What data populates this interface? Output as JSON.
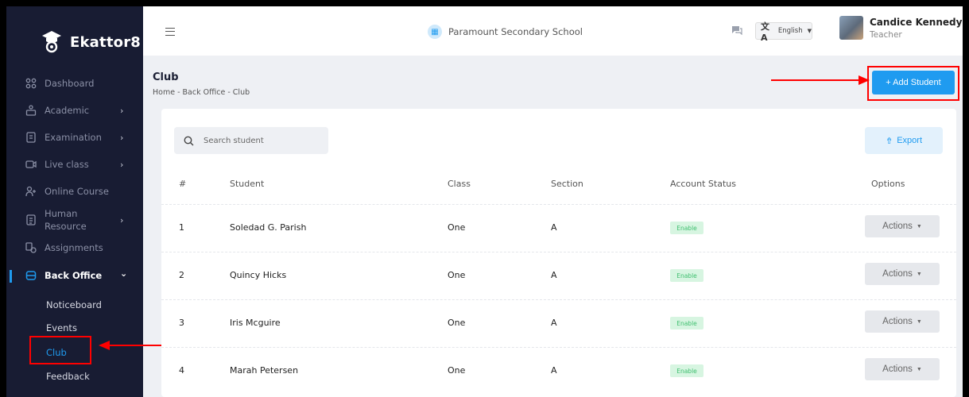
{
  "brand": {
    "name": "Ekattor8"
  },
  "sidebar": {
    "items": [
      {
        "label": "Dashboard",
        "icon": "grid-icon",
        "chevron": ""
      },
      {
        "label": "Academic",
        "icon": "academic-icon",
        "chevron": "›"
      },
      {
        "label": "Examination",
        "icon": "exam-icon",
        "chevron": "›"
      },
      {
        "label": "Live class",
        "icon": "video-icon",
        "chevron": "›"
      },
      {
        "label": "Online Course",
        "icon": "user-plus-icon",
        "chevron": ""
      },
      {
        "label": "Human",
        "label2": "Resource",
        "icon": "document-icon",
        "chevron": "›"
      },
      {
        "label": "Assignments",
        "icon": "assignment-icon",
        "chevron": ""
      },
      {
        "label": "Back Office",
        "icon": "database-icon",
        "chevron": "⌄"
      }
    ],
    "subitems": [
      "Noticeboard",
      "Events",
      "Club",
      "Feedback"
    ]
  },
  "header": {
    "school": "Paramount Secondary School",
    "language": "English",
    "user_name": "Candice Kennedy",
    "user_role": "Teacher"
  },
  "page": {
    "title": "Club",
    "breadcrumb": "Home - Back Office - Club",
    "add_button": "+ Add Student"
  },
  "toolbar": {
    "search_placeholder": "Search student",
    "export_label": "Export"
  },
  "table": {
    "headers": [
      "#",
      "Student",
      "Class",
      "Section",
      "Account Status",
      "Options"
    ],
    "rows": [
      {
        "num": "1",
        "student": "Soledad G. Parish",
        "class": "One",
        "section": "A",
        "status": "Enable",
        "action": "Actions"
      },
      {
        "num": "2",
        "student": "Quincy Hicks",
        "class": "One",
        "section": "A",
        "status": "Enable",
        "action": "Actions"
      },
      {
        "num": "3",
        "student": "Iris Mcguire",
        "class": "One",
        "section": "A",
        "status": "Enable",
        "action": "Actions"
      },
      {
        "num": "4",
        "student": "Marah Petersen",
        "class": "One",
        "section": "A",
        "status": "Enable",
        "action": "Actions"
      }
    ]
  },
  "colors": {
    "accent": "#1f9bf0",
    "sidebar": "#181c33",
    "annotation": "#ff0000",
    "success": "#3fbf6f"
  }
}
